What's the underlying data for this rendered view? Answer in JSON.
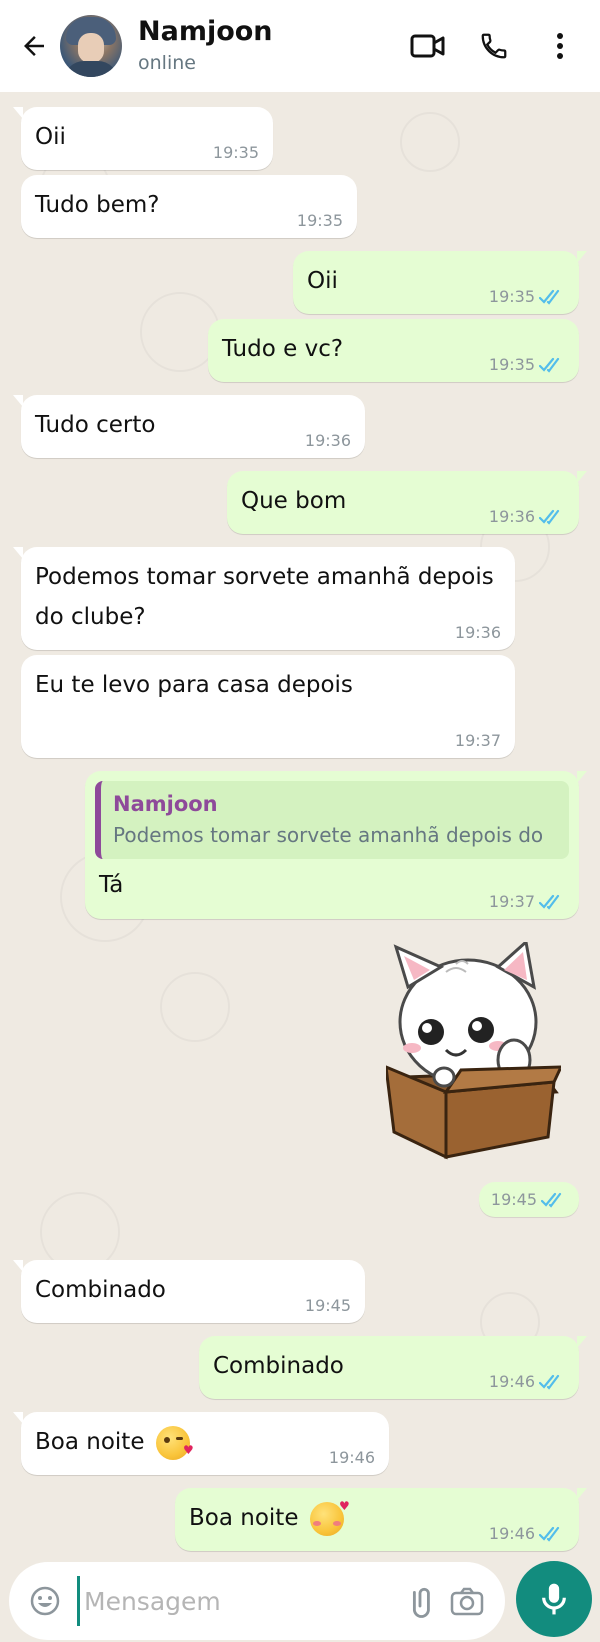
{
  "header": {
    "contact_name": "Namjoon",
    "status": "online",
    "icons": [
      "back-arrow-icon",
      "video-call-icon",
      "phone-icon",
      "more-vert-icon"
    ]
  },
  "messages": [
    {
      "direction": "in",
      "text": "Oii",
      "time": "19:35"
    },
    {
      "direction": "in",
      "text": "Tudo bem?",
      "time": "19:35"
    },
    {
      "direction": "out",
      "text": "Oii",
      "time": "19:35",
      "read": true
    },
    {
      "direction": "out",
      "text": "Tudo e vc?",
      "time": "19:35",
      "read": true
    },
    {
      "direction": "in",
      "text": "Tudo certo",
      "time": "19:36"
    },
    {
      "direction": "out",
      "text": "Que bom",
      "time": "19:36",
      "read": true
    },
    {
      "direction": "in",
      "text": "Podemos tomar sorvete amanhã depois do clube?",
      "time": "19:36"
    },
    {
      "direction": "in",
      "text": "Eu te levo para casa depois",
      "time": "19:37"
    },
    {
      "direction": "out",
      "text": "Tá",
      "time": "19:37",
      "read": true,
      "reply_to": {
        "name": "Namjoon",
        "text": "Podemos tomar sorvete amanhã depois do"
      }
    },
    {
      "direction": "out",
      "type": "sticker",
      "sticker": "white-cat-in-box",
      "time": "19:45",
      "read": true
    },
    {
      "direction": "in",
      "text": "Combinado",
      "time": "19:45"
    },
    {
      "direction": "out",
      "text": "Combinado",
      "time": "19:46",
      "read": true
    },
    {
      "direction": "in",
      "text": "Boa noite",
      "emoji": "kissing-heart",
      "time": "19:46"
    },
    {
      "direction": "out",
      "text": "Boa noite",
      "emoji": "smiling-face-with-hearts",
      "time": "19:46",
      "read": true
    }
  ],
  "input": {
    "placeholder": "Mensagem",
    "value": ""
  },
  "colors": {
    "incoming_bubble": "#ffffff",
    "outgoing_bubble": "#e5fdd3",
    "chat_background": "#efeae2",
    "read_ticks": "#53bdeb",
    "accent": "#128c7e",
    "quote_name": "#8e4a9a"
  }
}
